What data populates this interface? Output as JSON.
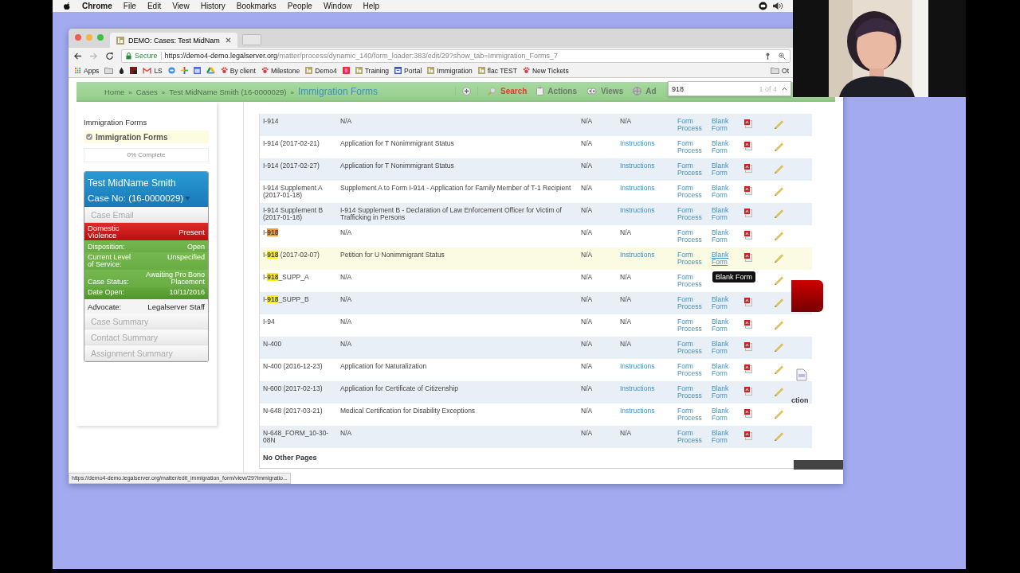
{
  "menu_bar": {
    "items": [
      "Chrome",
      "File",
      "Edit",
      "View",
      "History",
      "Bookmarks",
      "People",
      "Window",
      "Help"
    ]
  },
  "browser": {
    "tab": {
      "title": "DEMO: Cases: Test MidNam",
      "selected": true
    },
    "address": {
      "secure_label": "Secure",
      "url_host": "https://demo4-demo.legalserver.org",
      "url_path": "/matter/process/dynamic_140/form_loader:383/edit/29?show_tab=Immigration_Forms_7"
    },
    "bookmarks": [
      {
        "kind": "grid",
        "label": "Apps"
      },
      {
        "kind": "folder"
      },
      {
        "kind": "drop"
      },
      {
        "kind": "square"
      },
      {
        "kind": "mail",
        "label": "LS"
      },
      {
        "kind": "chat"
      },
      {
        "kind": "pinwheel"
      },
      {
        "kind": "calendar"
      },
      {
        "kind": "drive"
      },
      {
        "kind": "paw",
        "label": "By client"
      },
      {
        "kind": "paw",
        "label": "Milestone"
      },
      {
        "kind": "ls",
        "label": "Demo4"
      },
      {
        "kind": "book"
      },
      {
        "kind": "ls",
        "label": "Training"
      },
      {
        "kind": "window",
        "label": "Portal"
      },
      {
        "kind": "ls",
        "label": "Immigration"
      },
      {
        "kind": "ls",
        "label": "flac TEST"
      },
      {
        "kind": "paw",
        "label": "New Tickets"
      }
    ],
    "other_bookmarks": "Ot",
    "status_url": "https://demo4-demo.legalserver.org/matter/edit_immigration_form/view/29?immigratio..."
  },
  "nav": {
    "breadcrumb": [
      {
        "label": "Home",
        "current": false
      },
      {
        "label": "Cases",
        "current": false
      },
      {
        "label": "Test MidName Smith (16-0000029)",
        "current": false
      },
      {
        "label": "Immigration Forms",
        "current": true
      }
    ],
    "separator": "»",
    "buttons": [
      {
        "kind": "search",
        "label": "Search",
        "active": true
      },
      {
        "kind": "clipboard",
        "label": "Actions",
        "active": false
      },
      {
        "kind": "eyes",
        "label": "Views",
        "active": false
      },
      {
        "kind": "globe",
        "label": "Ad",
        "active": false
      }
    ]
  },
  "find_bar": {
    "value": "918",
    "count": "1 of 4"
  },
  "sidebar": {
    "title": "Immigration Forms",
    "steps": [
      {
        "label": "Immigration Forms",
        "done": true,
        "selected": true
      }
    ],
    "progress": "0% Complete",
    "case_card": {
      "name": "Test MidName Smith",
      "case_no": "Case No: (16-0000029)",
      "rows": [
        {
          "kind": "link",
          "label": "Case Email"
        },
        {
          "kind": "alert",
          "label": "Domestic Violence",
          "value": "Present"
        },
        {
          "kind": "field",
          "label": "Disposition:",
          "value": "Open"
        },
        {
          "kind": "field",
          "label": "Current Level of Service:",
          "value": "Unspecified"
        },
        {
          "kind": "field",
          "label": "Case Status:",
          "value": "Awaiting Pro Bono Placement"
        },
        {
          "kind": "field",
          "label": "Date Open:",
          "value": "10/11/2016"
        },
        {
          "kind": "plain",
          "label": "Advocate:",
          "value": "Legalserver Staff"
        },
        {
          "kind": "link",
          "label": "Case Summary"
        },
        {
          "kind": "link",
          "label": "Contact Summary"
        },
        {
          "kind": "link",
          "label": "Assignment Summary"
        }
      ]
    }
  },
  "table": {
    "rows": [
      {
        "name_parts": [
          {
            "text": "I-914",
            "highlighted": false,
            "current": false
          }
        ],
        "description": "N/A",
        "column_3": "N/A",
        "column_4": {
          "text": "N/A",
          "link": false
        },
        "form": "Form Process",
        "blank": "Blank Form",
        "hovered": false
      },
      {
        "name_parts": [
          {
            "text": "I-914 (2017-02-21)",
            "highlighted": false,
            "current": false
          }
        ],
        "description": "Application for T Nonimmigrant Status",
        "column_3": "N/A",
        "column_4": {
          "text": "Instructions",
          "link": true
        },
        "form": "Form Process",
        "blank": "Blank Form",
        "hovered": false
      },
      {
        "name_parts": [
          {
            "text": "I-914 (2017-02-27)",
            "highlighted": false,
            "current": false
          }
        ],
        "description": "Application for T Nonimmigrant Status",
        "column_3": "N/A",
        "column_4": {
          "text": "Instructions",
          "link": true
        },
        "form": "Form Process",
        "blank": "Blank Form",
        "hovered": false
      },
      {
        "name_parts": [
          {
            "text": "I-914 Supplement A (2017-01-18)",
            "highlighted": false,
            "current": false
          }
        ],
        "description": "Supplement A to Form I-914 - Application for Family Member of T-1 Recipient",
        "column_3": "N/A",
        "column_4": {
          "text": "Instructions",
          "link": true
        },
        "form": "Form Process",
        "blank": "Blank Form",
        "hovered": false
      },
      {
        "name_parts": [
          {
            "text": "I-914 Supplement B (2017-01-18)",
            "highlighted": false,
            "current": false
          }
        ],
        "description": "I-914 Supplement B - Declaration of Law Enforcement Officer for Victim of Trafficking in Persons",
        "column_3": "N/A",
        "column_4": {
          "text": "Instructions",
          "link": true
        },
        "form": "Form Process",
        "blank": "Blank Form",
        "hovered": false
      },
      {
        "name_parts": [
          {
            "text": "I-",
            "highlighted": false,
            "current": false
          },
          {
            "text": "918",
            "highlighted": true,
            "current": true
          }
        ],
        "description": "N/A",
        "column_3": "N/A",
        "column_4": {
          "text": "N/A",
          "link": false
        },
        "form": "Form Process",
        "blank": "Blank Form",
        "hovered": false
      },
      {
        "name_parts": [
          {
            "text": "I-",
            "highlighted": false,
            "current": false
          },
          {
            "text": "918",
            "highlighted": true,
            "current": false
          },
          {
            "text": " (2017-02-07)",
            "highlighted": false,
            "current": false
          }
        ],
        "description": "Petition for U Nonimmigrant Status",
        "column_3": "N/A",
        "column_4": {
          "text": "Instructions",
          "link": true
        },
        "form": "Form Process",
        "blank": "Blank Form",
        "hovered": true
      },
      {
        "name_parts": [
          {
            "text": "I-",
            "highlighted": false,
            "current": false
          },
          {
            "text": "918",
            "highlighted": true,
            "current": false
          },
          {
            "text": "_SUPP_A",
            "highlighted": false,
            "current": false
          }
        ],
        "description": "N/A",
        "column_3": "N/A",
        "column_4": {
          "text": "N/A",
          "link": false
        },
        "form": "Form Process",
        "hovered": false
      },
      {
        "name_parts": [
          {
            "text": "I-",
            "highlighted": false,
            "current": false
          },
          {
            "text": "918",
            "highlighted": true,
            "current": false
          },
          {
            "text": "_SUPP_B",
            "highlighted": false,
            "current": false
          }
        ],
        "description": "N/A",
        "column_3": "N/A",
        "column_4": {
          "text": "N/A",
          "link": false
        },
        "form": "Form Process",
        "blank": "Blank Form",
        "hovered": false
      },
      {
        "name_parts": [
          {
            "text": "I-94",
            "highlighted": false,
            "current": false
          }
        ],
        "description": "N/A",
        "column_3": "N/A",
        "column_4": {
          "text": "N/A",
          "link": false
        },
        "form": "Form Process",
        "blank": "Blank Form",
        "hovered": false
      },
      {
        "name_parts": [
          {
            "text": "N-400",
            "highlighted": false,
            "current": false
          }
        ],
        "description": "N/A",
        "column_3": "N/A",
        "column_4": {
          "text": "N/A",
          "link": false
        },
        "form": "Form Process",
        "blank": "Blank Form",
        "hovered": false
      },
      {
        "name_parts": [
          {
            "text": "N-400 (2016-12-23)",
            "highlighted": false,
            "current": false
          }
        ],
        "description": "Application for Naturalization",
        "column_3": "N/A",
        "column_4": {
          "text": "Instructions",
          "link": true
        },
        "form": "Form Process",
        "blank": "Blank Form",
        "hovered": false
      },
      {
        "name_parts": [
          {
            "text": "N-600 (2017-02-13)",
            "highlighted": false,
            "current": false
          }
        ],
        "description": "Application for Certificate of Citizenship",
        "column_3": "N/A",
        "column_4": {
          "text": "Instructions",
          "link": true
        },
        "form": "Form Process",
        "blank": "Blank Form",
        "hovered": false
      },
      {
        "name_parts": [
          {
            "text": "N-648 (2017-03-21)",
            "highlighted": false,
            "current": false
          }
        ],
        "description": "Medical Certification for Disability Exceptions",
        "column_3": "N/A",
        "column_4": {
          "text": "Instructions",
          "link": true
        },
        "form": "Form Process",
        "blank": "Blank Form",
        "hovered": false
      },
      {
        "name_parts": [
          {
            "text": "N-648_FORM_10-30-08N",
            "highlighted": false,
            "current": false
          }
        ],
        "description": "N/A",
        "column_3": "N/A",
        "column_4": {
          "text": "N/A",
          "link": false
        },
        "form": "Form Process",
        "blank": "Blank Form",
        "hovered": false
      }
    ],
    "footer": "No Other Pages"
  },
  "tooltip": "Blank Form",
  "background_fragment": {
    "text": "ction"
  }
}
